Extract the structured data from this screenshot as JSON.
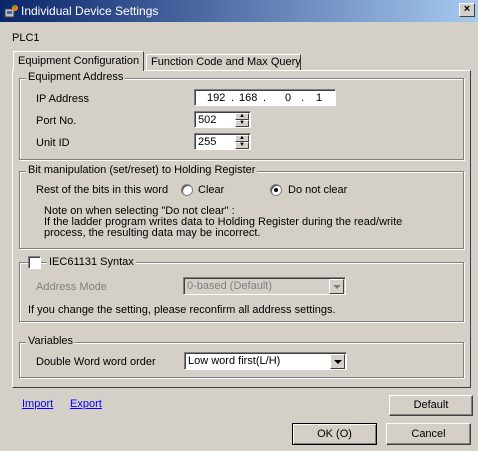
{
  "window": {
    "title": "Individual Device Settings",
    "close_label": "×"
  },
  "device_name": "PLC1",
  "tabs": [
    {
      "label": "Equipment Configuration"
    },
    {
      "label": "Function Code and Max Query"
    }
  ],
  "equipment_address": {
    "group_title": "Equipment Address",
    "ip_label": "IP Address",
    "ip": [
      "192",
      "168",
      "0",
      "1"
    ],
    "port_label": "Port No.",
    "port_value": "502",
    "unit_label": "Unit ID",
    "unit_value": "255"
  },
  "bit_manipulation": {
    "group_title": "Bit manipulation (set/reset) to Holding Register",
    "rest_label": "Rest of the bits in this word",
    "option_clear": "Clear",
    "option_do_not_clear": "Do not clear",
    "selected": "Do not clear",
    "note_line1": "Note on when selecting \"Do not clear\" :",
    "note_line2": "If the ladder program writes data to Holding Register during the read/write",
    "note_line3": "process, the resulting data may be incorrect."
  },
  "iec": {
    "checkbox_label": "IEC61131 Syntax",
    "checked": false,
    "address_mode_label": "Address Mode",
    "address_mode_value": "0-based (Default)",
    "reconfirm_note": "If you change the setting, please reconfirm all address settings."
  },
  "variables": {
    "group_title": "Variables",
    "dword_label": "Double Word word order",
    "dword_value": "Low word first(L/H)"
  },
  "footer": {
    "import_label": "Import",
    "export_label": "Export",
    "default_label": "Default",
    "ok_label": "OK (O)",
    "cancel_label": "Cancel"
  }
}
